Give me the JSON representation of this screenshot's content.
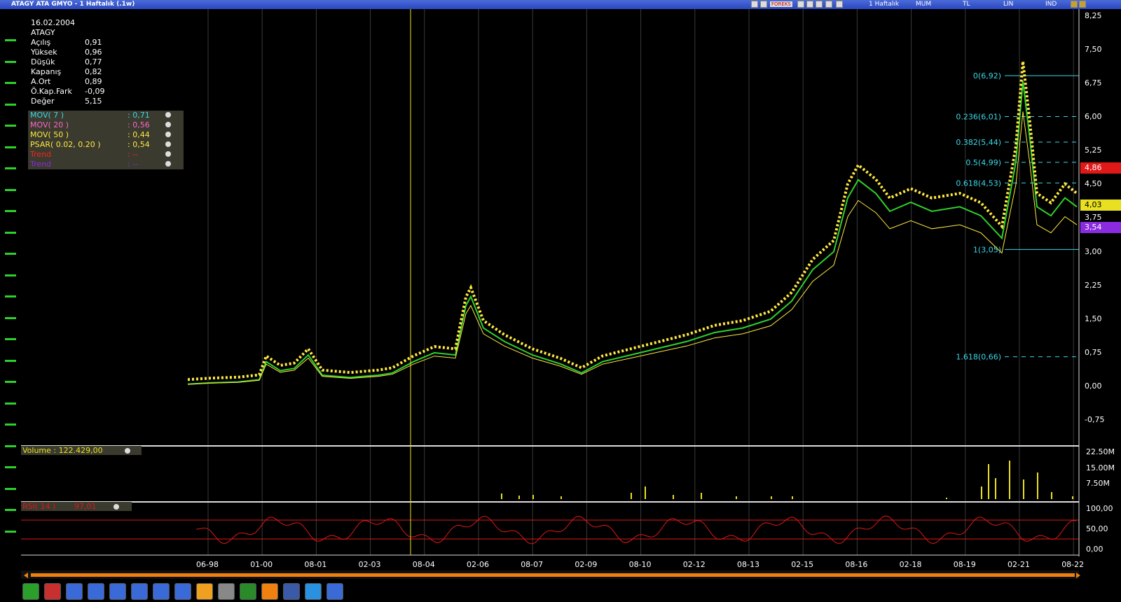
{
  "window": {
    "title": "ATAGY ATA GMYO - 1 Haftalık (.1w)",
    "period_label": "1 Haftalık",
    "chart_type": "MUM",
    "currency": "TL",
    "scale": "LIN",
    "mode": "IND",
    "forex_label": "FOREKS"
  },
  "info": [
    {
      "k": "16.02.2004",
      "v": ""
    },
    {
      "k": "ATAGY",
      "v": ""
    },
    {
      "k": "Açılış",
      "v": "0,91"
    },
    {
      "k": "Yüksek",
      "v": "0,96"
    },
    {
      "k": "Düşük",
      "v": "0,77"
    },
    {
      "k": "Kapanış",
      "v": "0,82"
    },
    {
      "k": "A.Ort",
      "v": "0,89"
    },
    {
      "k": "Ö.Kap.Fark",
      "v": "-0,09"
    },
    {
      "k": "Değer",
      "v": "5,15"
    }
  ],
  "indicators": [
    {
      "name": "MOV( 7 )",
      "value": ": 0,71",
      "color": "#3ad8e8"
    },
    {
      "name": "MOV( 20 )",
      "value": ": 0,56",
      "color": "#ff66cc"
    },
    {
      "name": "MOV( 50 )",
      "value": ": 0,44",
      "color": "#ffe840"
    },
    {
      "name": "PSAR( 0.02, 0.20 )",
      "value": ": 0,54",
      "color": "#ffe840"
    },
    {
      "name": "Trend",
      "value": ": --",
      "color": "#ff2020"
    },
    {
      "name": "Trend",
      "value": ": --",
      "color": "#8a2be2"
    }
  ],
  "volume_panel": {
    "label": "Volume : 122.429,00",
    "axis": [
      "22.50M",
      "15.00M",
      "7.50M"
    ]
  },
  "rsi_panel": {
    "label": "RSI( 14 )",
    "value": "97,01",
    "axis": [
      "100,00",
      "50,00",
      "0,00"
    ]
  },
  "price_axis": [
    "8,25",
    "7,50",
    "6,75",
    "6,00",
    "5,25",
    "4,50",
    "3,75",
    "3,00",
    "2,25",
    "1,50",
    "0,75",
    "0,00",
    "-0,75"
  ],
  "price_tags": [
    {
      "text": "4,86",
      "bg": "#e01818",
      "fg": "#ffffff"
    },
    {
      "text": "4,03",
      "bg": "#e8e020",
      "fg": "#000000"
    },
    {
      "text": "3,54",
      "bg": "#8a2be2",
      "fg": "#ffffff"
    }
  ],
  "fib_labels": [
    "0(6,92)",
    "0.236(6,01)",
    "0.382(5,44)",
    "0.5(4,99)",
    "0.618(4,53)",
    "1(3,05)",
    "1.618(0,66)"
  ],
  "x_axis": [
    "06-98",
    "01-00",
    "08-01",
    "02-03",
    "08-04",
    "02-06",
    "08-07",
    "02-09",
    "08-10",
    "02-12",
    "08-13",
    "02-15",
    "08-16",
    "02-18",
    "08-19",
    "02-21",
    "08-22"
  ],
  "left_tool_icons": [
    "cursor-icon",
    "pencil-icon",
    "text-icon",
    "horizontal-line-icon",
    "vertical-line-icon",
    "channel-icon",
    "trendline-icon",
    "grid-icon",
    "arc-icon",
    "fan-icon",
    "fibonacci-icon",
    "fibo-fan-icon",
    "fibo-time-icon",
    "gann-icon",
    "gann-fan-icon",
    "gann-grid-icon",
    "cycle-icon",
    "zigzag-icon",
    "ruler-icon",
    "arrow-icon",
    "arrow-left-icon",
    "extend-icon",
    "parallel-icon",
    "eraser-icon"
  ],
  "bottom_toolbar_icons": [
    "portfolio-icon",
    "stock-icon",
    "network-icon",
    "search-icon",
    "refresh-icon",
    "print-preview-icon",
    "zoom-icon",
    "database-icon",
    "layout-icon",
    "print-icon",
    "excel-icon",
    "share-icon",
    "facebook-icon",
    "twitter-icon",
    "settings-icon"
  ],
  "top_icons": [
    "chart-icon",
    "alarm-icon",
    "forex-icon",
    "compare-icon",
    "draw-icon",
    "calendar-icon",
    "globe-icon",
    "chart2-icon"
  ]
}
